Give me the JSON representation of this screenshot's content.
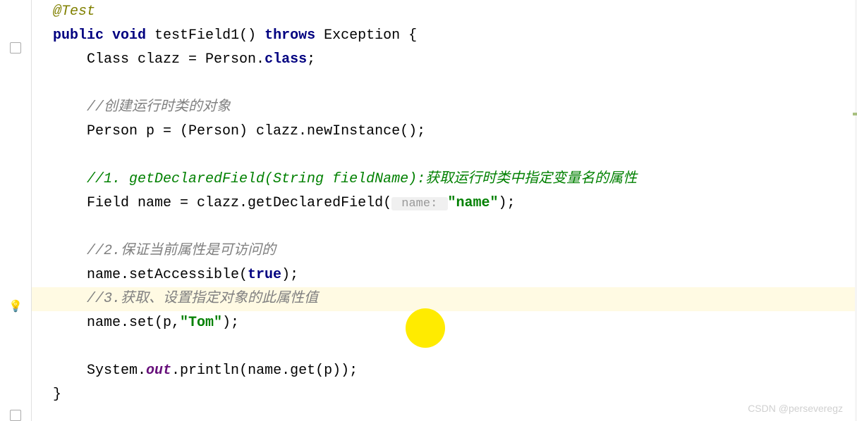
{
  "code": {
    "line1_annotation": "@Test",
    "line2_public": "public",
    "line2_void": "void",
    "line2_method": " testField1() ",
    "line2_throws": "throws",
    "line2_exception": " Exception {",
    "line3_prefix": "    Class clazz = Person.",
    "line3_class": "class",
    "line3_suffix": ";",
    "line5_comment": "    //创建运行时类的对象",
    "line6": "    Person p = (Person) clazz.newInstance();",
    "line8_comment": "    //1. getDeclaredField(String fieldName):获取运行时类中指定变量名的属性",
    "line9_prefix": "    Field name = clazz.getDeclaredField(",
    "line9_hint": " name: ",
    "line9_string": "\"name\"",
    "line9_suffix": ");",
    "line11_comment": "    //2.保证当前属性是可访问的",
    "line12_prefix": "    name.setAccessible(",
    "line12_true": "true",
    "line12_suffix": ");",
    "line13_comment": "    //3.获取、设置指定对象的此属性值",
    "line14_prefix": "    name.set(p,",
    "line14_string": "\"Tom\"",
    "line14_suffix": ");",
    "line16_prefix": "    System.",
    "line16_out": "out",
    "line16_suffix": ".println(name.get(p));",
    "line17": "}"
  },
  "watermark": "CSDN @perseveregz",
  "gutter": {
    "bulb": "💡"
  }
}
